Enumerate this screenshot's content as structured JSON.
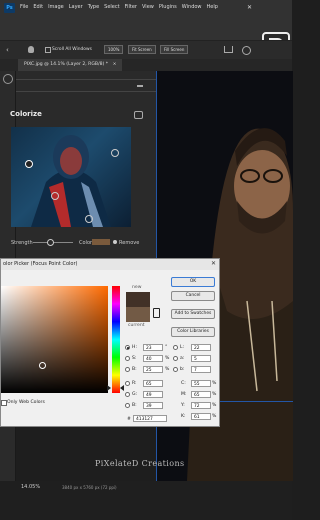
{
  "app": {
    "logo_text": "Ps",
    "menu": [
      "File",
      "Edit",
      "Image",
      "Layer",
      "Type",
      "Select",
      "Filter",
      "View",
      "Plugins",
      "Window",
      "Help"
    ],
    "close_glyph": "✕"
  },
  "options_bar": {
    "scroll_all_windows": "Scroll All Windows",
    "zoom_pct": "100%",
    "fit_screen": "Fit Screen",
    "fill_screen": "Fill Screen"
  },
  "document_tab": {
    "label": "PIXC.jpg @ 14.1% (Layer 2, RGB/8) *",
    "close_glyph": "×"
  },
  "colorize_panel": {
    "title": "Colorize",
    "strength_label": "Strength",
    "color_label": "Color",
    "remove_label": "Remove"
  },
  "color_picker": {
    "title": "olor Picker (Focus Point Color)",
    "new_label": "new",
    "current_label": "current",
    "ok_label": "OK",
    "cancel_label": "Cancel",
    "add_swatches_label": "Add to Swatches",
    "color_libraries_label": "Color Libraries",
    "only_web_colors": "Only Web Colors",
    "hsb": [
      {
        "label": "H:",
        "value": "23",
        "unit": "°"
      },
      {
        "label": "S:",
        "value": "40",
        "unit": "%"
      },
      {
        "label": "B:",
        "value": "25",
        "unit": "%"
      }
    ],
    "rgb": [
      {
        "label": "R:",
        "value": "65"
      },
      {
        "label": "G:",
        "value": "49"
      },
      {
        "label": "B:",
        "value": "39"
      }
    ],
    "lab": [
      {
        "label": "L:",
        "value": "22"
      },
      {
        "label": "a:",
        "value": "5"
      },
      {
        "label": "b:",
        "value": "7"
      }
    ],
    "cmyk": [
      {
        "label": "C:",
        "value": "55",
        "unit": "%"
      },
      {
        "label": "M:",
        "value": "65",
        "unit": "%"
      },
      {
        "label": "Y:",
        "value": "72",
        "unit": "%"
      },
      {
        "label": "K:",
        "value": "61",
        "unit": "%"
      }
    ],
    "hex_label": "#",
    "hex_value": "413127",
    "new_color": "#413127",
    "current_color": "#725a45"
  },
  "watermark": "PiXelateD Creations",
  "status": {
    "zoom": "14.05%",
    "doc_info": "3840 px x 5760 px (72 ppi)"
  }
}
